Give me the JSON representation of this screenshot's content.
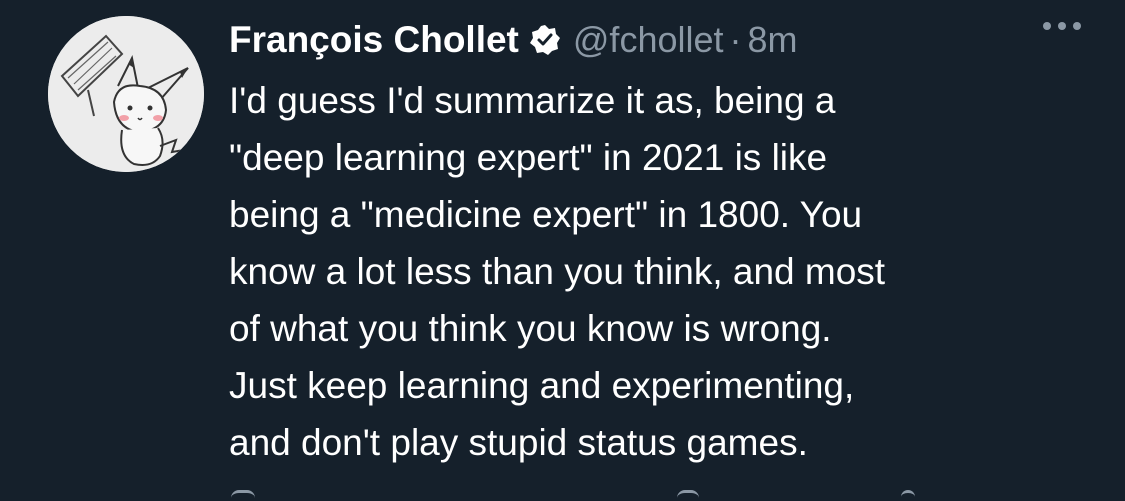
{
  "tweet": {
    "author": {
      "display_name": "François Chollet",
      "handle": "@fchollet",
      "verified_icon": "verified-badge-icon",
      "avatar_icon": "pikachu-sketch-avatar"
    },
    "separator": "·",
    "time": "8m",
    "text_lines": [
      "I'd guess I'd summarize it as, being a",
      "\"deep learning expert\" in 2021 is like",
      "being a \"medicine expert\" in 1800. You",
      "know a lot less than you think, and most",
      "of what you think you know is wrong.",
      "Just keep learning and experimenting,",
      "and don't play stupid status games."
    ],
    "more_icon": "more-options-icon"
  },
  "colors": {
    "background": "#15202b",
    "text": "#ffffff",
    "secondary_text": "#8b98a5"
  }
}
